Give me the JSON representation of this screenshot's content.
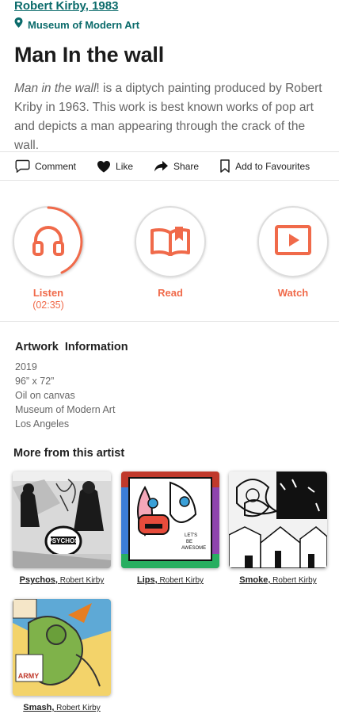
{
  "header": {
    "artist_link": "Robert Kirby, 1983",
    "museum": "Museum of Modern Art"
  },
  "artwork": {
    "title": "Man In the wall",
    "desc_italic": "Man in the wall",
    "desc_rest": "! is a diptych painting produced by Robert Kriby in 1963. This work is best known works of pop art and depicts a man appearing through the crack of the wall."
  },
  "actions": {
    "comment": "Comment",
    "like": "Like",
    "share": "Share",
    "favourites": "Add to Favourites"
  },
  "media": {
    "listen": "Listen",
    "listen_duration": "(02:35)",
    "read": "Read",
    "watch": "Watch",
    "accent_color": "#f06a4a"
  },
  "info": {
    "heading": "Artwork  Information",
    "year": "2019",
    "size": "96” x 72”",
    "medium": "Oil on canvas",
    "location": "Museum of Modern Art",
    "city": "Los Angeles"
  },
  "more": {
    "heading": "More from this artist",
    "items": [
      {
        "title": "Psychos,",
        "artist": "Robert Kirby"
      },
      {
        "title": "Lips,",
        "artist": "Robert Kirby"
      },
      {
        "title": "Smoke,",
        "artist": "Robert Kirby"
      },
      {
        "title": "Smash,",
        "artist": "Robert Kirby"
      }
    ]
  }
}
